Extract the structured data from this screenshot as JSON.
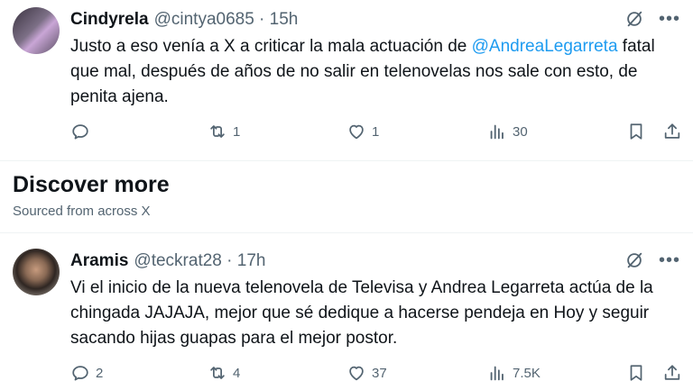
{
  "tweets": [
    {
      "name": "Cindyrela",
      "handle": "@cintya0685 · 15h",
      "text_before": "Justo a eso venía a X a criticar la mala actuación de ",
      "mention": "@AndreaLegarreta",
      "text_after": " fatal que mal, después de años de no salir en telenovelas nos sale con esto, de penita ajena.",
      "reply_count": "",
      "repost_count": "1",
      "like_count": "1",
      "view_count": "30"
    },
    {
      "name": "Aramis",
      "handle": "@teckrat28 · 17h",
      "text": "Vi el inicio de la nueva telenovela de Televisa y Andrea Legarreta actúa de la chingada JAJAJA, mejor que sé dedique a hacerse pendeja en Hoy y seguir sacando hijas guapas para el mejor postor.",
      "reply_count": "2",
      "repost_count": "4",
      "like_count": "37",
      "view_count": "7.5K"
    }
  ],
  "discover": {
    "title": "Discover more",
    "subtitle": "Sourced from across X"
  },
  "icons": {
    "reply": "reply-icon",
    "repost": "repost-icon",
    "like": "heart-icon",
    "views": "views-icon",
    "bookmark": "bookmark-icon",
    "share": "share-icon",
    "grok": "grok-icon",
    "more": "more-icon"
  },
  "colors": {
    "text": "#0f1419",
    "secondary": "#536471",
    "mention": "#1d9bf0",
    "divider": "#eff3f4"
  }
}
